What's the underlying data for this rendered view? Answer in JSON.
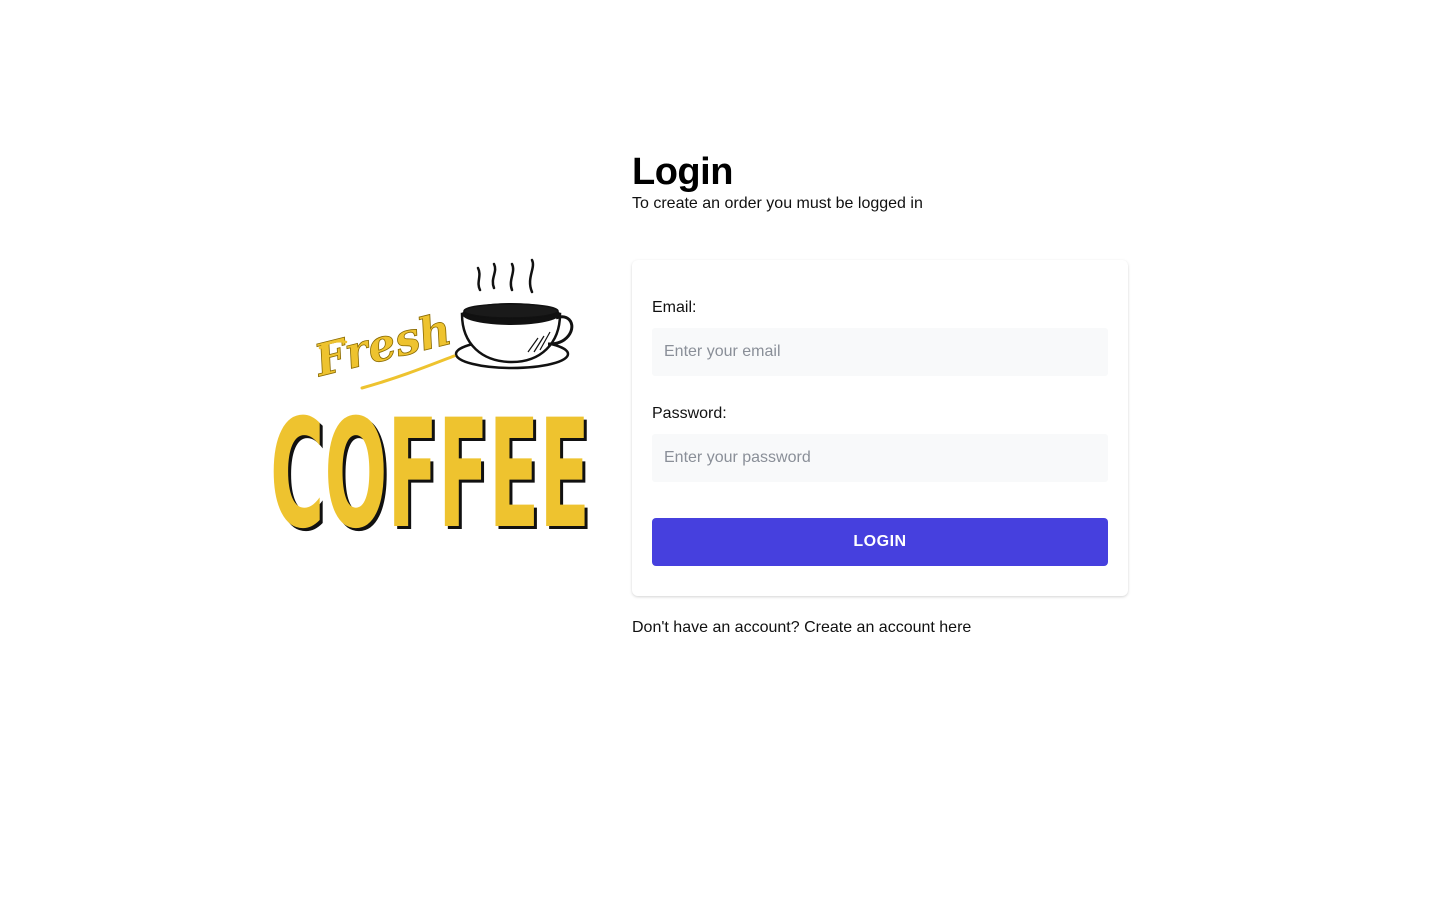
{
  "logo": {
    "top_text": "Fresh",
    "main_text": "COFFEE",
    "accent_color": "#eec32f",
    "ink_color": "#111111",
    "icon": "coffee-cup-icon"
  },
  "header": {
    "title": "Login",
    "subtitle": "To create an order you must be logged in"
  },
  "form": {
    "email_label": "Email:",
    "email_placeholder": "Enter your email",
    "email_value": "",
    "password_label": "Password:",
    "password_placeholder": "Enter your password",
    "password_value": "",
    "submit_label": "LOGIN",
    "submit_color": "#4640de"
  },
  "footer": {
    "prompt": "Don't have an account?",
    "link_label": "Create an account here"
  }
}
